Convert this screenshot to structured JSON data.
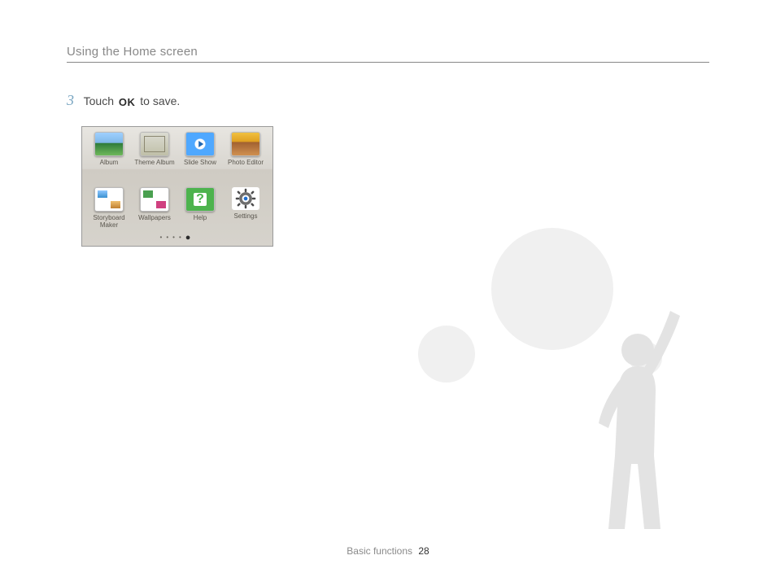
{
  "header": {
    "title": "Using the Home screen"
  },
  "step": {
    "number": "3",
    "prefix": "Touch ",
    "ok_glyph": "OK",
    "suffix": " to save."
  },
  "screenshot": {
    "apps": [
      {
        "label": "Album"
      },
      {
        "label": "Theme Album"
      },
      {
        "label": "Slide Show"
      },
      {
        "label": "Photo Editor"
      },
      {
        "label": "Storyboard Maker"
      },
      {
        "label": "Wallpapers"
      },
      {
        "label": "Help"
      },
      {
        "label": "Settings"
      }
    ],
    "help_glyph": "?"
  },
  "footer": {
    "section": "Basic functions",
    "page": "28"
  }
}
